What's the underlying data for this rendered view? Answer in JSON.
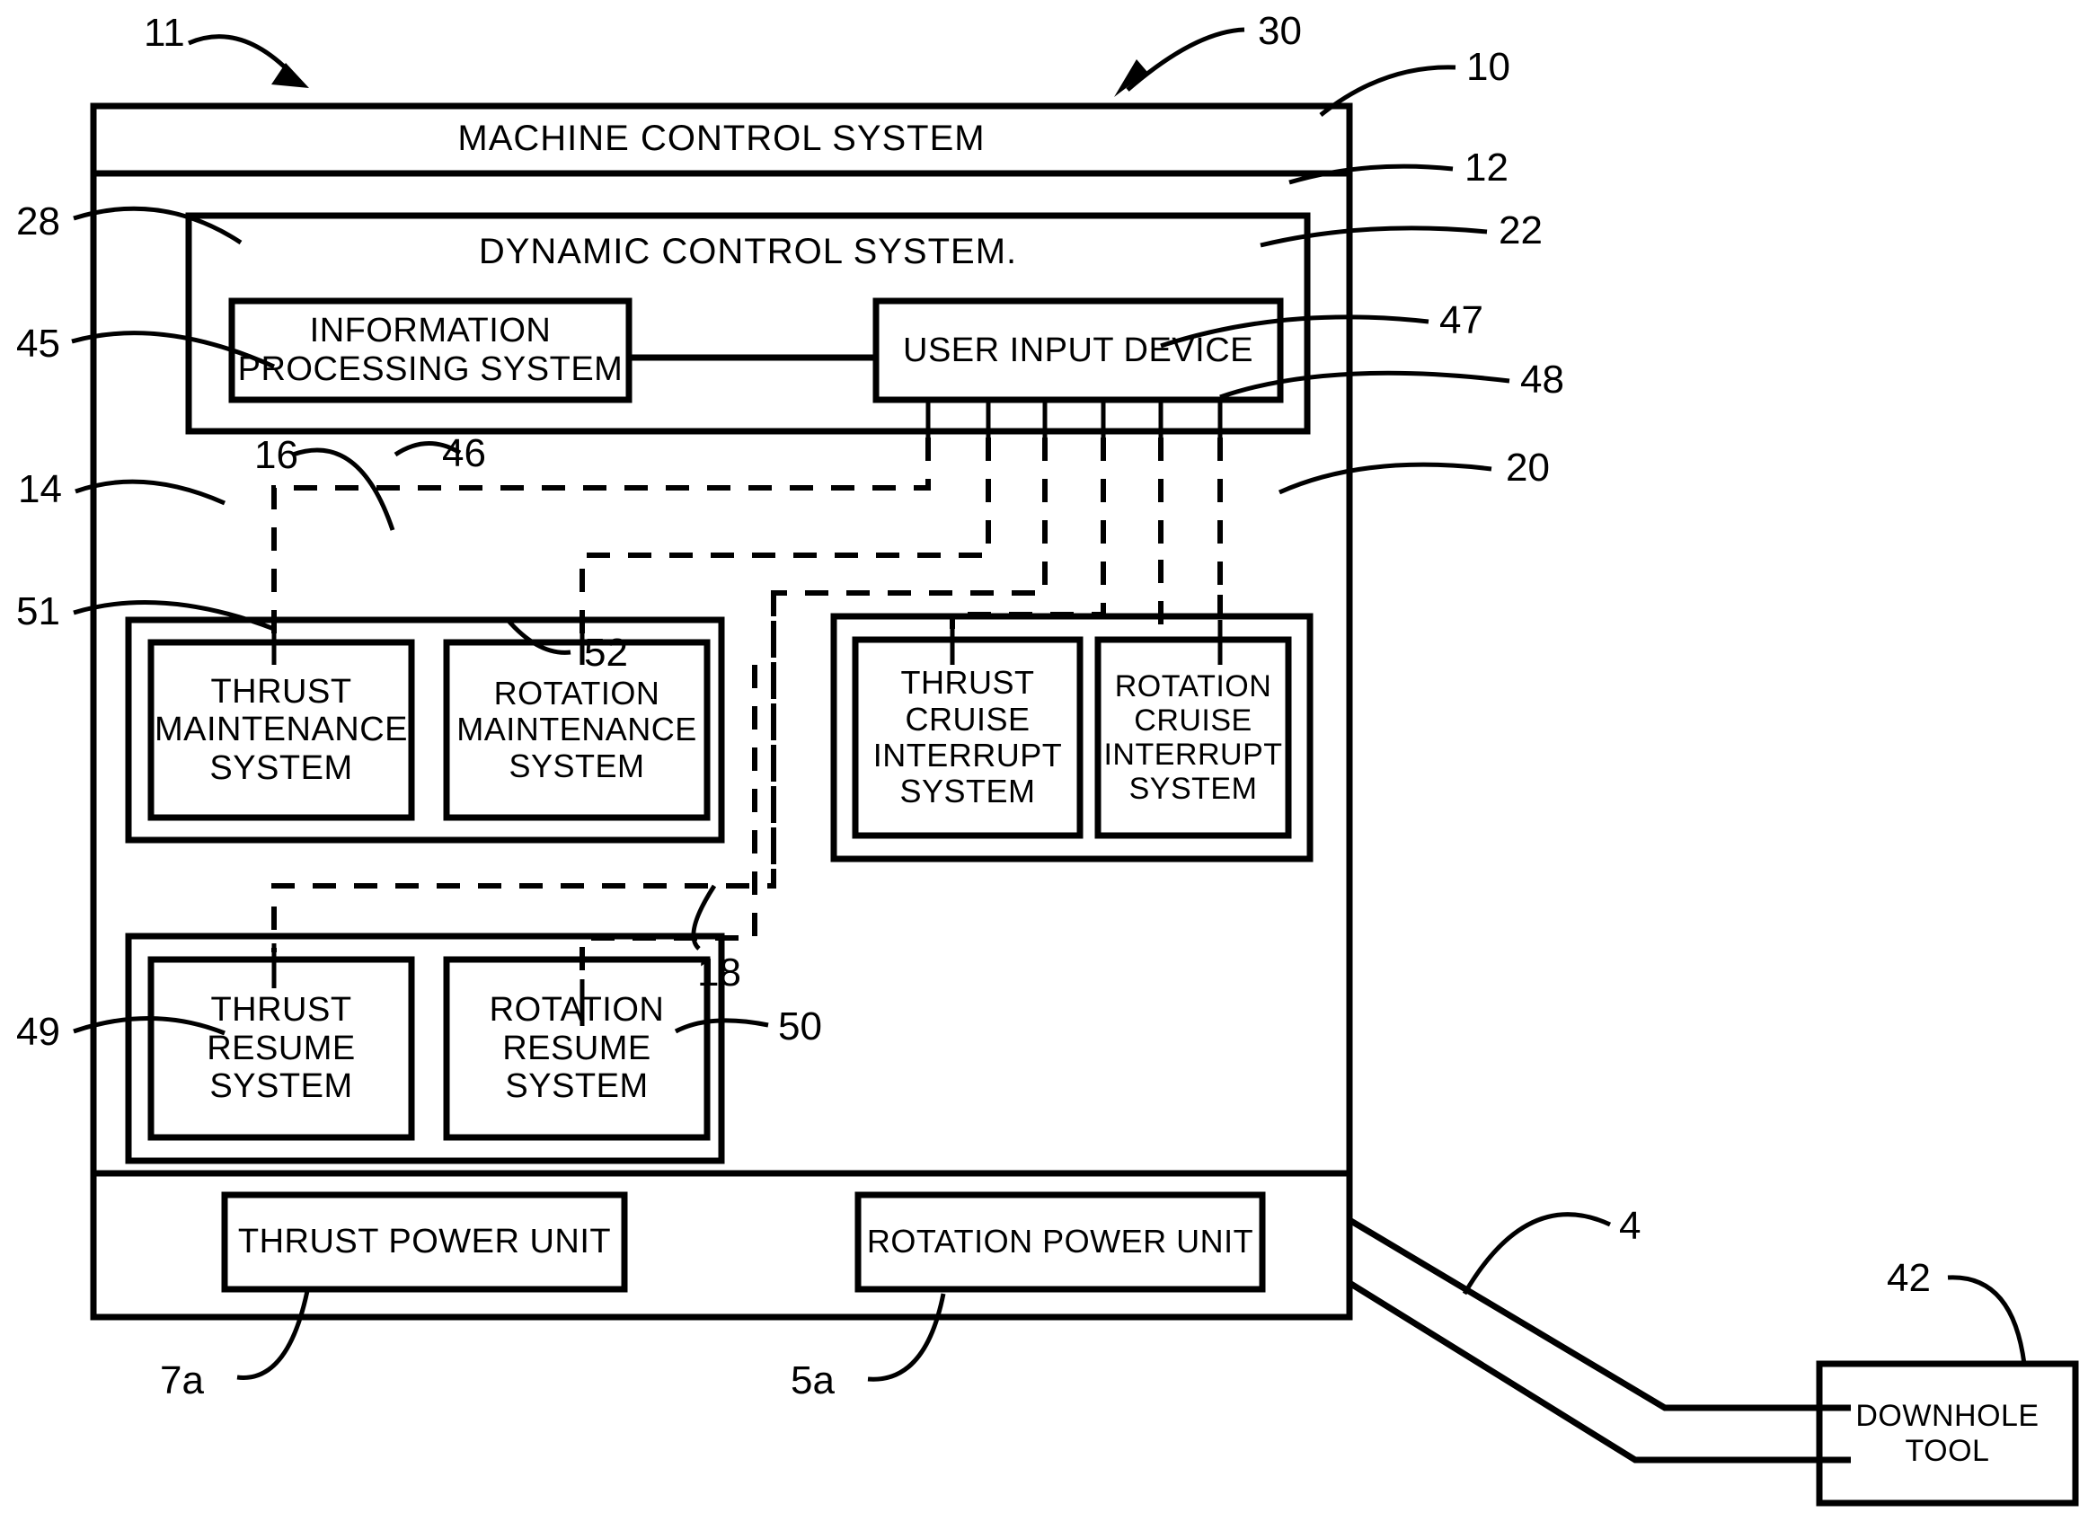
{
  "figure": {
    "type": "patent-block-diagram",
    "background": "#ffffff",
    "ink": "#000000"
  },
  "outer": {
    "machine_control_system": "MACHINE CONTROL SYSTEM",
    "dynamic_control_system": "DYNAMIC CONTROL SYSTEM."
  },
  "blocks": {
    "information_processing_system": "INFORMATION\nPROCESSING SYSTEM",
    "user_input_device": "USER INPUT DEVICE",
    "thrust_maintenance_system": "THRUST\nMAINTENANCE\nSYSTEM",
    "rotation_maintenance_system": "ROTATION\nMAINTENANCE\nSYSTEM",
    "thrust_cruise_interrupt_system": "THRUST\nCRUISE\nINTERRUPT\nSYSTEM",
    "rotation_cruise_interrupt_system": "ROTATION\nCRUISE\nINTERRUPT\nSYSTEM",
    "thrust_resume_system": "THRUST\nRESUME\nSYSTEM",
    "rotation_resume_system": "ROTATION\nRESUME\nSYSTEM",
    "thrust_power_unit": "THRUST POWER UNIT",
    "rotation_power_unit": "ROTATION POWER UNIT",
    "downhole_tool": "DOWNHOLE\nTOOL"
  },
  "numerals": {
    "n11": "11",
    "n30": "30",
    "n10": "10",
    "n12": "12",
    "n28": "28",
    "n22": "22",
    "n45": "45",
    "n47": "47",
    "n16": "16",
    "n46": "46",
    "n48": "48",
    "n14": "14",
    "n20": "20",
    "n51": "51",
    "n18": "18",
    "n52": "52",
    "n49": "49",
    "n50": "50",
    "n7a": "7a",
    "n5a": "5a",
    "n4": "4",
    "n42": "42"
  }
}
